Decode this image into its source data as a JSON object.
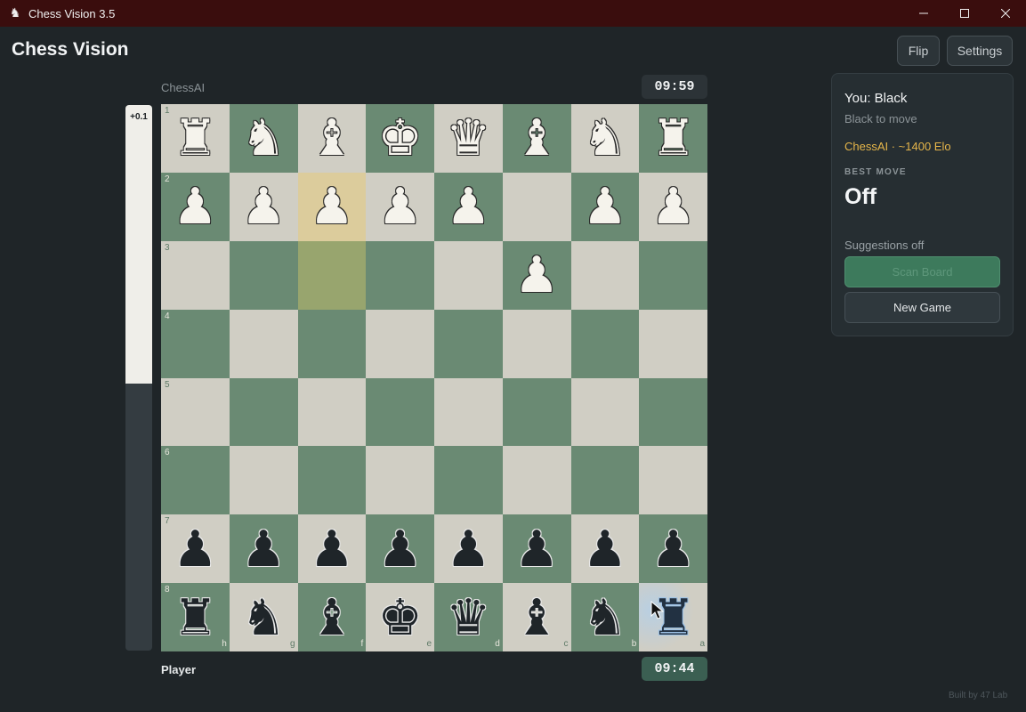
{
  "window": {
    "title": "Chess Vision 3.5",
    "app_icon": "chess-knight-icon",
    "controls": [
      "minimize-icon",
      "maximize-icon",
      "close-icon"
    ]
  },
  "header": {
    "title": "Chess Vision",
    "flip_label": "Flip",
    "settings_label": "Settings"
  },
  "opponent": {
    "name": "ChessAI",
    "clock": "09:59"
  },
  "player": {
    "name": "Player",
    "clock": "09:44"
  },
  "eval": {
    "text": "+0.1",
    "white_fraction": 0.51
  },
  "board": {
    "orientation": "black",
    "ranks": [
      "1",
      "2",
      "3",
      "4",
      "5",
      "6",
      "7",
      "8"
    ],
    "files": [
      "h",
      "g",
      "f",
      "e",
      "d",
      "c",
      "b",
      "a"
    ],
    "rows": [
      [
        "wR",
        "wN",
        "wB",
        "wK",
        "wQ",
        "wB",
        "wN",
        "wR"
      ],
      [
        "wP",
        "wP",
        "wP",
        "wP",
        "wP",
        "",
        "wP",
        "wP"
      ],
      [
        "",
        "",
        "",
        "",
        "",
        "wP",
        "",
        ""
      ],
      [
        "",
        "",
        "",
        "",
        "",
        "",
        "",
        ""
      ],
      [
        "",
        "",
        "",
        "",
        "",
        "",
        "",
        ""
      ],
      [
        "",
        "",
        "",
        "",
        "",
        "",
        "",
        ""
      ],
      [
        "bP",
        "bP",
        "bP",
        "bP",
        "bP",
        "bP",
        "bP",
        "bP"
      ],
      [
        "bR",
        "bN",
        "bB",
        "bK",
        "bQ",
        "bB",
        "bN",
        "bR"
      ]
    ],
    "last_move_from": "f2",
    "last_move_to": "f3",
    "hover_square": "a8",
    "colors": {
      "light": "#d0cec4",
      "dark": "#6a8a73",
      "from": "#dccc9c",
      "to": "#98a56e"
    }
  },
  "panel": {
    "you_label": "You: Black",
    "turn_label": "Black to move",
    "engine_label": "ChessAI · ~1400 Elo",
    "best_move_heading": "BEST MOVE",
    "best_move_value": "Off",
    "suggestions_label": "Suggestions off",
    "scan_button": "Scan Board",
    "new_game_button": "New Game"
  },
  "footer": "Built by 47 Lab"
}
